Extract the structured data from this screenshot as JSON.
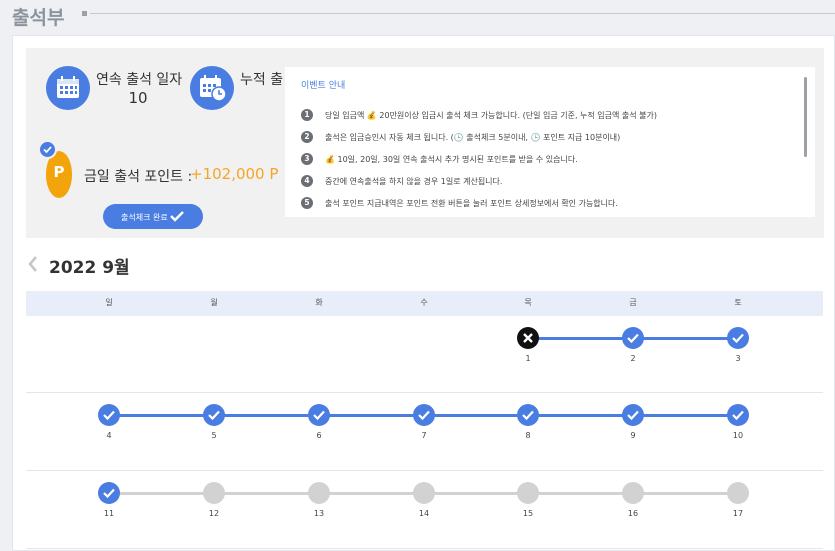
{
  "page": {
    "title": "출석부"
  },
  "summary": {
    "consecutive_label": "연속 출석 일자",
    "consecutive_value": "10",
    "cumulative_label": "누적 출",
    "points_label": "금일 출석 포인트 :",
    "points_value": "+102,000 P",
    "checkin_button": "출석체크 완료",
    "coin_letter": "P",
    "icons": [
      "calendar-icon",
      "calendar-clock-icon",
      "point-coin-icon",
      "check-icon"
    ]
  },
  "notice": {
    "title": "이벤트 안내",
    "items": [
      {
        "num": "1",
        "text": "당일 입금액 💰 20만원이상 입금시 출석 체크 가능합니다. (단일 입금 기준, 누적 입금액 출석 불가)"
      },
      {
        "num": "2",
        "text": "출석은 입금승인시 자동 체크 됩니다. (🕒 출석체크 5분이내, 🕒 포인트 지급 10분이내)"
      },
      {
        "num": "3",
        "text": "💰 10일, 20일, 30일 연속 출석시 추가 명시된 포인트를 받을 수 있습니다."
      },
      {
        "num": "4",
        "text": "중간에 연속출석을 하지 않을 경우 1일로 계산됩니다."
      },
      {
        "num": "5",
        "text": "출석 포인트 지급내역은 포인트 전환 버튼을 눌러 포인트 상세정보에서 확인 가능합니다."
      }
    ]
  },
  "calendar": {
    "month_label": "2022 9월",
    "weekdays": [
      "일",
      "월",
      "화",
      "수",
      "목",
      "금",
      "토"
    ],
    "weeks": [
      [
        {
          "day": "",
          "status": "none"
        },
        {
          "day": "",
          "status": "none"
        },
        {
          "day": "",
          "status": "none"
        },
        {
          "day": "",
          "status": "none"
        },
        {
          "day": "1",
          "status": "missed"
        },
        {
          "day": "2",
          "status": "checked"
        },
        {
          "day": "3",
          "status": "checked"
        }
      ],
      [
        {
          "day": "4",
          "status": "checked"
        },
        {
          "day": "5",
          "status": "checked"
        },
        {
          "day": "6",
          "status": "checked"
        },
        {
          "day": "7",
          "status": "checked"
        },
        {
          "day": "8",
          "status": "checked"
        },
        {
          "day": "9",
          "status": "checked"
        },
        {
          "day": "10",
          "status": "checked"
        }
      ],
      [
        {
          "day": "11",
          "status": "checked"
        },
        {
          "day": "12",
          "status": "future"
        },
        {
          "day": "13",
          "status": "future"
        },
        {
          "day": "14",
          "status": "future"
        },
        {
          "day": "15",
          "status": "future"
        },
        {
          "day": "16",
          "status": "future"
        },
        {
          "day": "17",
          "status": "future"
        }
      ]
    ]
  },
  "colors": {
    "accent": "#4a7de1",
    "points": "#f5a623",
    "coin": "#f3a40a",
    "missed": "#111111",
    "future": "#d2d2d2"
  }
}
